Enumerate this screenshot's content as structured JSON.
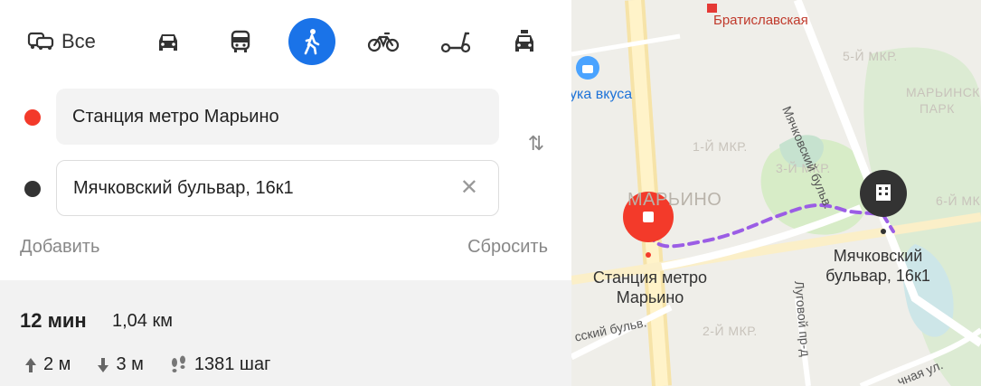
{
  "transport_modes": {
    "all_label": "Все",
    "items": [
      "car",
      "bus",
      "walk",
      "bicycle",
      "scooter",
      "taxi"
    ],
    "active": "walk",
    "accent_color": "#1a73e8"
  },
  "route_form": {
    "from": {
      "value": "Станция метро Марьино",
      "dot_color": "#f33a2a"
    },
    "to": {
      "value": "Мячковский бульвар, 16к1",
      "dot_color": "#333333",
      "clear_symbol": "✕"
    },
    "swap_symbol": "⇅",
    "add_label": "Добавить",
    "reset_label": "Сбросить"
  },
  "route_summary": {
    "time": "12 мин",
    "distance": "1,04 км",
    "ascent": "2 м",
    "descent": "3 м",
    "steps": "1381 шаг"
  },
  "map": {
    "metro_station": "Братиславская",
    "shop_label": "ука вкуса",
    "districts": [
      "5-Й МКР.",
      "МАРЬИНСК",
      "ПАРК",
      "1-Й МКР.",
      "3-Й МКР.",
      "МАРЬИНО",
      "6-Й МКР.",
      "2-Й МКР."
    ],
    "streets": [
      "Мячковский бульв.",
      "Луговой пр-д",
      "сский бульв.",
      "чная ул."
    ],
    "start_label_line1": "Станция метро",
    "start_label_line2": "Марьино",
    "end_label_line1": "Мячковский",
    "end_label_line2": "бульвар, 16к1",
    "route_color": "#9b5de5",
    "start_pin_color": "#f33a2a",
    "end_pin_color": "#333333"
  }
}
